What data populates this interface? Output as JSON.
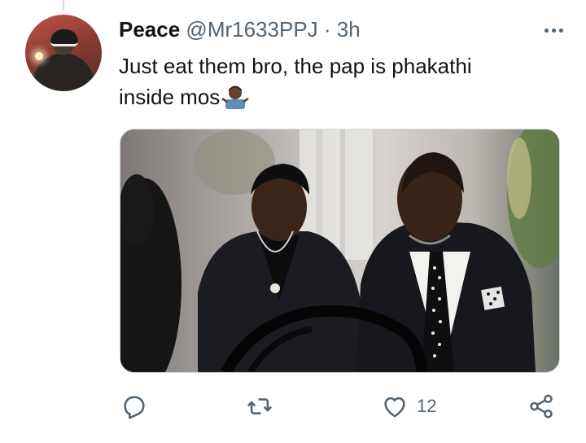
{
  "tweet": {
    "author_name": "Peace",
    "handle": "@Mr1633PPJ",
    "separator": "·",
    "time": "3h",
    "text_line1": "Just eat them bro, the pap is phakathi",
    "text_line2": "inside mos",
    "emoji": "man-shrugging-emoji"
  },
  "media": {
    "description_icon": "photo"
  },
  "actions": {
    "reply": {
      "icon": "reply-icon",
      "count": ""
    },
    "retweet": {
      "icon": "retweet-icon",
      "count": ""
    },
    "like": {
      "icon": "heart-icon",
      "count": "12"
    },
    "share": {
      "icon": "share-icon",
      "count": ""
    }
  },
  "colors": {
    "text": "#0f1419",
    "secondary": "#536471",
    "border": "#cfd9de"
  }
}
